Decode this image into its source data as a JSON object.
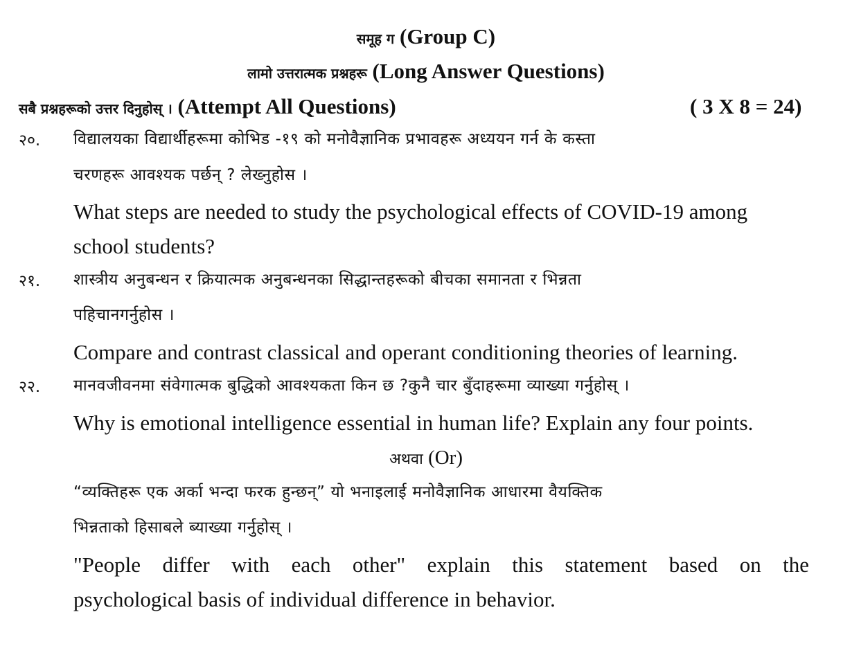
{
  "header": {
    "group_np": "समूह ग",
    "group_en": "(Group C)",
    "type_np": "लामो उत्तरात्मक प्रश्नहरू",
    "type_en": "(Long Answer Questions)",
    "instruction_np": "सबै प्रश्नहरूको उत्तर दिनुहोस् ।",
    "instruction_en": "(Attempt All Questions)",
    "marks": "( 3 X 8 = 24)"
  },
  "questions": [
    {
      "number": "२०.",
      "np_line1": "विद्यालयका विद्यार्थीहरूमा कोभिड -१९  को मनोवैज्ञानिक प्रभावहरू अध्ययन गर्न के कस्ता",
      "np_line2": "चरणहरू आवश्यक पर्छन् ? लेख्नुहोस ।",
      "en_line1": "What steps are needed to study the psychological effects of COVID-19 among",
      "en_line2": "school students?"
    },
    {
      "number": "२१.",
      "np_line1": "शास्त्रीय अनुबन्धन र क्रियात्मक अनुबन्धनका सिद्धान्तहरूको बीचका  समानता र भिन्नता",
      "np_line2": "पहिचानगर्नुहोस ।",
      "en_line1": "Compare and contrast classical and operant conditioning theories of learning."
    },
    {
      "number": "२२.",
      "np_line1": "मानवजीवनमा संवेगात्मक बुद्धिको आवश्यकता किन छ ?कुनै चार बुँदाहरूमा व्याख्या गर्नुहोस् ।",
      "en_line1": "Why is emotional intelligence essential in human life? Explain any four points.",
      "or_np": "अथवा",
      "or_en": "(Or)",
      "alt_np_line1": "“व्यक्तिहरू एक अर्का भन्दा  फरक हुन्छन्” यो भनाइलाई मनोवैज्ञानिक आधारमा वैयक्तिक",
      "alt_np_line2": "भिन्नताको हिसाबले ब्याख्या गर्नुहोस् ।",
      "alt_en_words": [
        "\"People",
        "differ",
        "with",
        "each",
        "other\"",
        "explain",
        "this",
        "statement",
        "based",
        "on",
        "the"
      ],
      "alt_en_line2": "psychological basis of individual difference in behavior."
    }
  ]
}
